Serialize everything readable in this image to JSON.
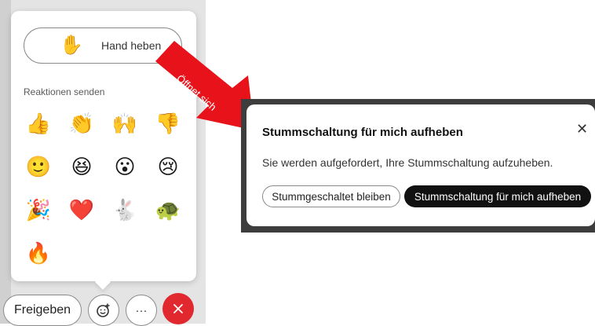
{
  "reactions_panel": {
    "raise_hand": {
      "icon": "raised-hand-icon",
      "glyph": "✋",
      "label": "Hand heben"
    },
    "section_label": "Reaktionen senden",
    "emojis": [
      {
        "name": "thumbs-up-emoji",
        "glyph": "👍"
      },
      {
        "name": "clapping-hands-emoji",
        "glyph": "👏"
      },
      {
        "name": "raising-hands-emoji",
        "glyph": "🙌"
      },
      {
        "name": "thumbs-down-emoji",
        "glyph": "👎"
      },
      {
        "name": "smiling-face-emoji",
        "glyph": "🙂"
      },
      {
        "name": "laughing-face-emoji",
        "glyph": "😆"
      },
      {
        "name": "surprised-face-emoji",
        "glyph": "😮"
      },
      {
        "name": "sad-face-emoji",
        "glyph": "😢"
      },
      {
        "name": "party-popper-emoji",
        "glyph": "🎉"
      },
      {
        "name": "heart-emoji",
        "glyph": "❤️"
      },
      {
        "name": "rabbit-emoji",
        "glyph": "🐇"
      },
      {
        "name": "turtle-emoji",
        "glyph": "🐢"
      },
      {
        "name": "fire-emoji",
        "glyph": "🔥"
      }
    ]
  },
  "control_bar": {
    "share_label": "Freigeben",
    "reactions_icon": "smiley-add-icon",
    "more_label": "···",
    "end_icon": "close-icon",
    "end_color": "#e0282e"
  },
  "annotation": {
    "arrow_text": "Öffnet sich",
    "arrow_color": "#e8121a"
  },
  "unmute_dialog": {
    "title": "Stummschaltung für mich aufheben",
    "close_glyph": "✕",
    "body": "Sie werden aufgefordert, Ihre Stummschaltung aufzuheben.",
    "stay_muted_label": "Stummgeschaltet bleiben",
    "unmute_label": "Stummschaltung für mich aufheben"
  }
}
